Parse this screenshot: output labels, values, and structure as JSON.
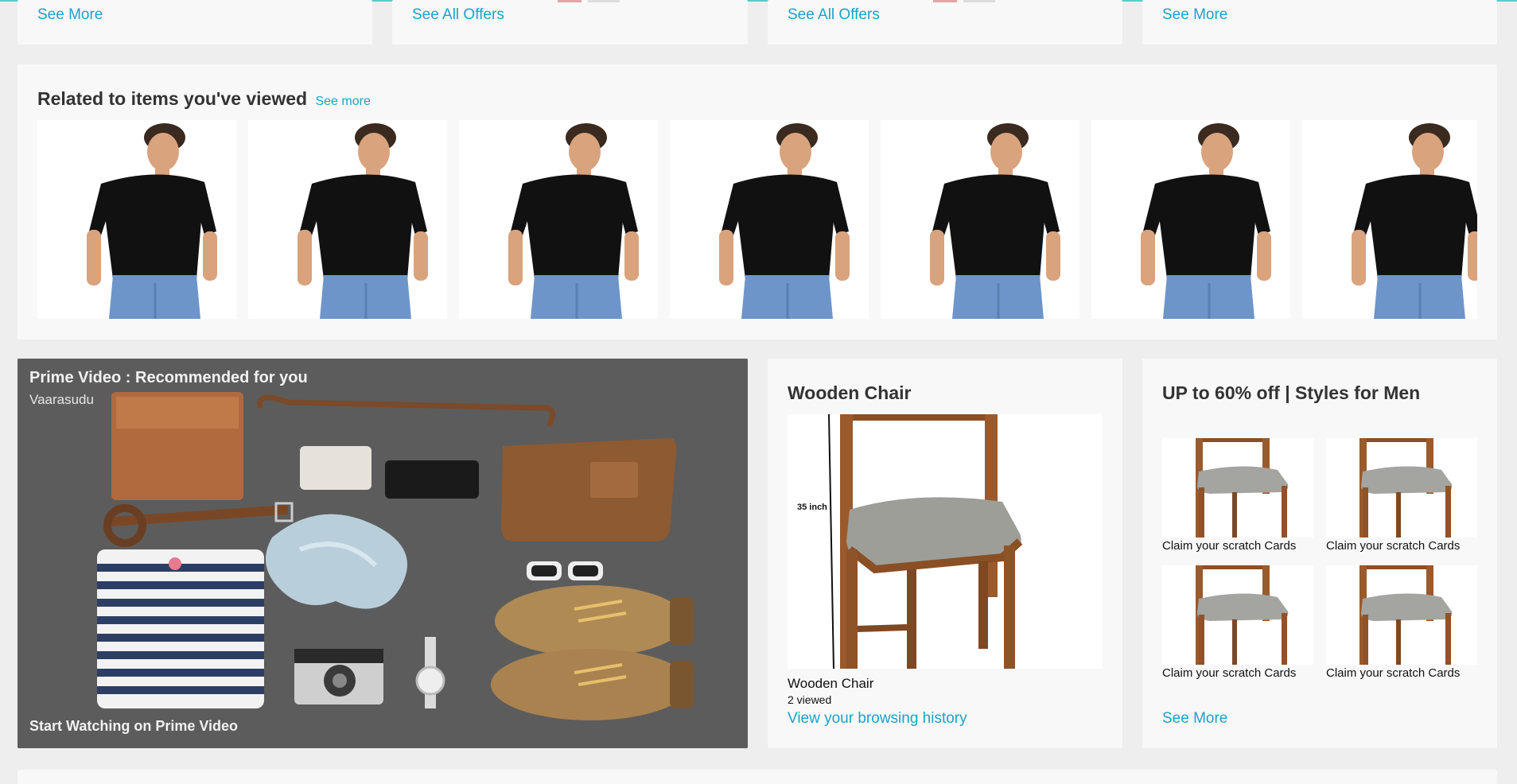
{
  "top_row": {
    "card1_link": "See More",
    "card2_link": "See All Offers",
    "card3_link": "See All Offers",
    "card4_link": "See More"
  },
  "related": {
    "title": "Related to items you've viewed",
    "see_more": "See more",
    "item_count": 7
  },
  "prime": {
    "title": "Prime Video : Recommended for you",
    "subtitle": "Vaarasudu",
    "cta": "Start Watching on Prime Video"
  },
  "wooden_chair": {
    "heading": "Wooden Chair",
    "dimension_label": "35 inch",
    "product_name": "Wooden Chair",
    "viewed_count": "2 viewed",
    "history_link": "View your browsing history"
  },
  "styles_men": {
    "heading": "UP to 60% off | Styles for Men",
    "items": [
      {
        "caption": "Claim your scratch Cards"
      },
      {
        "caption": "Claim your scratch Cards"
      },
      {
        "caption": "Claim your scratch Cards"
      },
      {
        "caption": "Claim your scratch Cards"
      }
    ],
    "see_more": "See More"
  },
  "colors": {
    "link": "#1aa3c8",
    "card_bg": "#f8f8f8",
    "page_bg": "#eeeeee",
    "top_accent": "#5fc9c9"
  }
}
